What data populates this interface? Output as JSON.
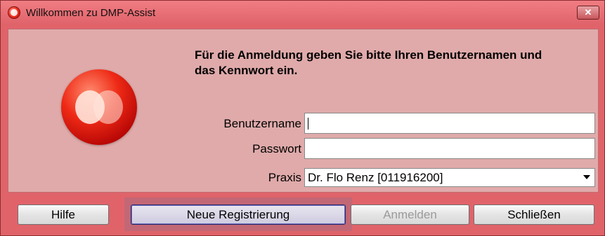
{
  "window": {
    "title": "Willkommen zu DMP-Assist",
    "close_glyph": "✕"
  },
  "instructions": "Für die Anmeldung geben Sie bitte Ihren Benutzernamen und das Kennwort ein.",
  "form": {
    "username_label": "Benutzername",
    "username_value": "",
    "password_label": "Passwort",
    "password_value": "",
    "practice_label": "Praxis",
    "practice_value": "Dr. Flo Renz [011916200]"
  },
  "buttons": {
    "help": "Hilfe",
    "new_registration": "Neue Registrierung",
    "login": "Anmelden",
    "close": "Schließen"
  },
  "colors": {
    "window_frame": "#e0636a",
    "panel": "#e0aaaa",
    "highlight": "#c26775"
  },
  "icons": {
    "app": "dmp-assist-logo-icon",
    "close": "close-icon",
    "dropdown": "chevron-down-icon"
  }
}
